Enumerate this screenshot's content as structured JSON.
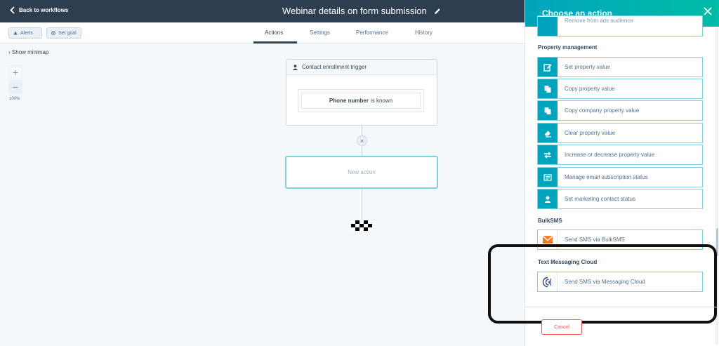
{
  "header": {
    "back_label": "Back to workflows",
    "title": "Webinar details on form submission"
  },
  "toolbar": {
    "alerts_label": "Alerts",
    "set_goal_label": "Set goal"
  },
  "tabs": [
    {
      "label": "Actions",
      "active": true
    },
    {
      "label": "Settings",
      "active": false
    },
    {
      "label": "Performance",
      "active": false
    },
    {
      "label": "History",
      "active": false
    }
  ],
  "canvas": {
    "show_minimap": "Show minimap",
    "zoom_in": "+",
    "zoom_out": "−",
    "zoom_level": "100%",
    "trigger_header": "Contact enrollment trigger",
    "trigger_property": "Phone number",
    "trigger_condition": "is known",
    "remove_symbol": "×",
    "new_action": "New action"
  },
  "panel": {
    "title": "Choose an action",
    "partial_item": "Remove from ads audience",
    "sections": [
      {
        "title": "Property management",
        "items": [
          {
            "label": "Set property value",
            "icon": "edit-icon"
          },
          {
            "label": "Copy property value",
            "icon": "copy-icon"
          },
          {
            "label": "Copy company property value",
            "icon": "copy-icon"
          },
          {
            "label": "Clear property value",
            "icon": "eraser-icon"
          },
          {
            "label": "Increase or decrease property value",
            "icon": "swap-arrows-icon"
          },
          {
            "label": "Manage email subscription status",
            "icon": "newspaper-icon"
          },
          {
            "label": "Set marketing contact status",
            "icon": "contact-icon"
          }
        ]
      },
      {
        "title": "BulkSMS",
        "items": [
          {
            "label": "Send SMS via BulkSMS",
            "icon": "envelope-logo-icon"
          }
        ]
      },
      {
        "title": "Text Messaging Cloud",
        "items": [
          {
            "label": "Send SMS via Messaging Cloud",
            "icon": "messaging-cloud-logo-icon"
          }
        ]
      }
    ],
    "cancel_label": "Cancel"
  },
  "colors": {
    "header_bg": "#2d3e50",
    "panel_gradient_start": "#00a4bd",
    "panel_gradient_end": "#00bda5",
    "action_icon_bg": "#00a4bd",
    "cancel": "#f2545b",
    "annotation_box": "#111111"
  }
}
